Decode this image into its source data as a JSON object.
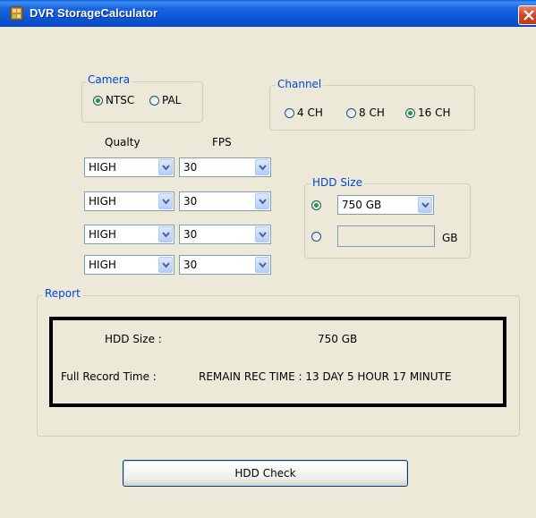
{
  "window": {
    "title": "DVR StorageCalculator"
  },
  "camera": {
    "label": "Camera",
    "options": [
      "NTSC",
      "PAL"
    ],
    "selected": "NTSC"
  },
  "channel": {
    "label": "Channel",
    "options": [
      "4 CH",
      "8 CH",
      "16 CH"
    ],
    "selected": "16 CH"
  },
  "table": {
    "quality_header": "Qualty",
    "fps_header": "FPS",
    "rows": [
      {
        "quality": "HIGH",
        "fps": "30"
      },
      {
        "quality": "HIGH",
        "fps": "30"
      },
      {
        "quality": "HIGH",
        "fps": "30"
      },
      {
        "quality": "HIGH",
        "fps": "30"
      }
    ]
  },
  "hdd": {
    "label": "HDD Size",
    "selected_value": "750 GB",
    "custom_value": "",
    "unit": "GB",
    "selected_option": "preset"
  },
  "report": {
    "label": "Report",
    "hdd_size_label": "HDD Size :",
    "hdd_size_value": "750 GB",
    "record_time_label": "Full Record Time :",
    "record_time_value": "REMAIN REC TIME : 13 DAY 5 HOUR 17 MINUTE"
  },
  "actions": {
    "hdd_check_label": "HDD Check"
  },
  "colors": {
    "legend": "#0046d5",
    "titlebar": "#0b56d3",
    "radio_dot": "#21a121",
    "background": "#ece9d8"
  },
  "icons": {
    "app": "dvr-app-icon",
    "close": "close-icon"
  }
}
